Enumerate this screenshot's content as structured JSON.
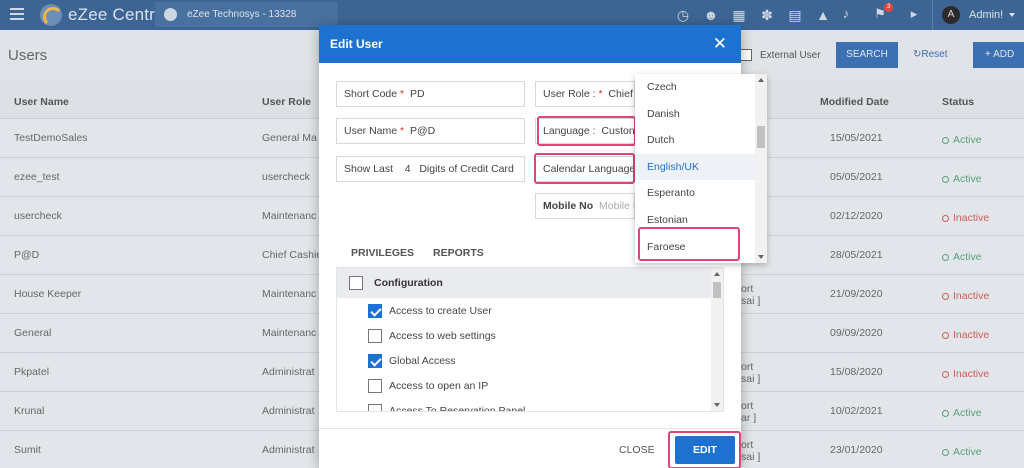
{
  "app": {
    "logo_text": "eZee Centrix",
    "property": "eZee Technosys -  13328"
  },
  "topbar": {
    "icons": [
      "person-clock-icon",
      "person-icon",
      "calendar-icon",
      "network-icon",
      "clipboard-icon",
      "chart-icon"
    ],
    "notification_badge": "3",
    "user_initial": "A",
    "user_name": "Admin!"
  },
  "page": {
    "title": "Users",
    "external_user_label": "External User",
    "search_label": "SEARCH",
    "reset_label": "↻Reset",
    "add_label": "+ ADD"
  },
  "table": {
    "headers": {
      "user_name": "User Name",
      "user_role": "User Role",
      "modified_date": "Modified Date",
      "status": "Status"
    },
    "rows": [
      {
        "name": "TestDemoSales",
        "role": "General Ma",
        "extra": "",
        "date": "15/05/2021",
        "status": "Active"
      },
      {
        "name": "ezee_test",
        "role": "usercheck",
        "extra": "",
        "date": "05/05/2021",
        "status": "Active"
      },
      {
        "name": "usercheck",
        "role": "Maintenanc",
        "extra": "",
        "date": "02/12/2020",
        "status": "Inactive"
      },
      {
        "name": "P@D",
        "role": "Chief Cashie",
        "extra": "",
        "date": "28/05/2021",
        "status": "Active"
      },
      {
        "name": "House Keeper",
        "role": "Maintenanc",
        "extra": "ort\nsai ]",
        "date": "21/09/2020",
        "status": "Inactive"
      },
      {
        "name": "General",
        "role": "Maintenanc",
        "extra": "",
        "date": "09/09/2020",
        "status": "Inactive"
      },
      {
        "name": "Pkpatel",
        "role": "Administrat",
        "extra": "ort\nsai ]",
        "date": "15/08/2020",
        "status": "Inactive"
      },
      {
        "name": "Krunal",
        "role": "Administrat",
        "extra": "ort\nar ]",
        "date": "10/02/2021",
        "status": "Active"
      },
      {
        "name": "Sumit",
        "role": "Administrat",
        "extra": "ort\nsai ]",
        "date": "23/01/2020",
        "status": "Active"
      }
    ]
  },
  "modal": {
    "title": "Edit User",
    "close_icon": "✕",
    "short_code_label": "Short Code",
    "short_code_value": "PD",
    "user_role_label": "User Role :",
    "user_role_value": "Chief",
    "user_name_label": "User Name",
    "user_name_value": "P@D",
    "language_label": "Language :",
    "language_value": "Custon",
    "show_last_label": "Show Last",
    "show_last_value": "4",
    "digits_label": "Digits of Credit Card",
    "calendar_language_label": "Calendar Language",
    "mobile_label": "Mobile No",
    "mobile_placeholder": "Mobile N",
    "required_mark": "*",
    "tabs": [
      "PRIVILEGES",
      "REPORTS"
    ],
    "section_title": "Configuration",
    "privileges": [
      {
        "label": "Access to create User",
        "checked": true
      },
      {
        "label": "Access to web settings",
        "checked": false
      },
      {
        "label": "Global Access",
        "checked": true
      },
      {
        "label": "Access to open an IP",
        "checked": false
      },
      {
        "label": "Access To Reservation Panel",
        "checked": false
      }
    ],
    "close_label": "CLOSE",
    "edit_label": "EDIT"
  },
  "language_dropdown": {
    "options": [
      "Czech",
      "Danish",
      "Dutch",
      "English/UK",
      "Esperanto",
      "Estonian",
      "Faroese"
    ],
    "selected": "English/UK"
  },
  "colors": {
    "header": "#3d6594",
    "accent": "#1e72cf",
    "highlight": "#e0447a",
    "active": "#5aa17a",
    "inactive": "#c9605a"
  }
}
